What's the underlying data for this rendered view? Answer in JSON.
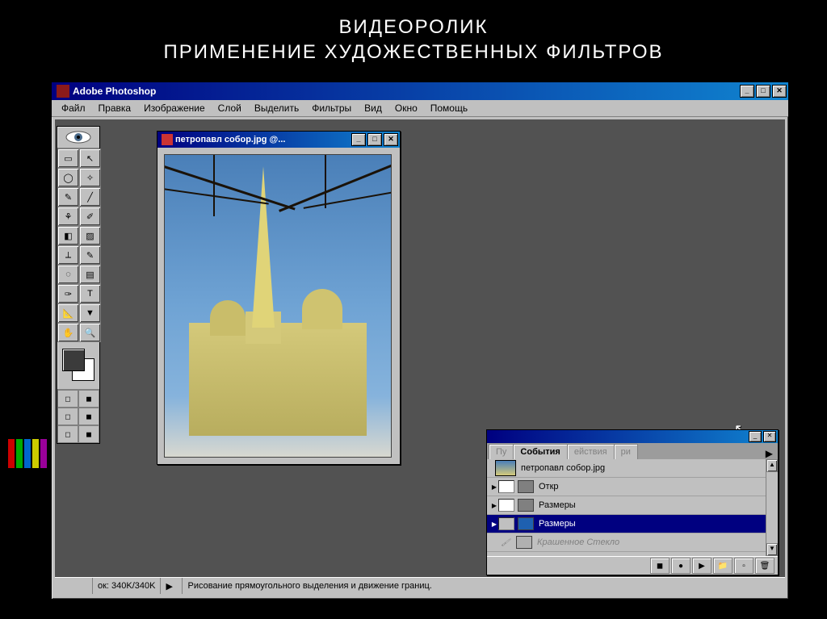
{
  "slide": {
    "title_line1": "ВИДЕОРОЛИК",
    "title_line2": "ПРИМЕНЕНИЕ ХУДОЖЕСТВЕННЫХ ФИЛЬТРОВ"
  },
  "app": {
    "title": "Adobe Photoshop",
    "menus": [
      "Файл",
      "Правка",
      "Изображение",
      "Слой",
      "Выделить",
      "Фильтры",
      "Вид",
      "Окно",
      "Помощь"
    ]
  },
  "toolbox": {
    "tools": [
      "▭",
      "↖",
      "◯",
      "✧",
      "✎",
      "╱",
      "⚘",
      "✐",
      "◧",
      "▨",
      "⟂",
      "✎",
      "◌",
      "▤",
      "✑",
      "T",
      "📐",
      "▼",
      "✋",
      "🔍"
    ],
    "modes": [
      "◻",
      "◼",
      "◻",
      "◼",
      "◻",
      "◼"
    ]
  },
  "document": {
    "title": "петропавл собор.jpg @..."
  },
  "palette": {
    "tabs_partial_left": "Пу",
    "tab_active": "События",
    "tabs_partial_right": "ействия",
    "tabs_partial_right2": "ри",
    "rows": [
      {
        "type": "head",
        "label": "петропавл собор.jpg"
      },
      {
        "type": "item",
        "label": "Откр"
      },
      {
        "type": "item",
        "label": "Размеры"
      },
      {
        "type": "sel",
        "label": "Размеры"
      },
      {
        "type": "italic",
        "label": "Крашенное Стекло"
      }
    ]
  },
  "status": {
    "doc": "ок: 340K/340K",
    "hint": "Рисование прямоугольного выделения и движение границ."
  },
  "window_controls": {
    "min": "_",
    "max": "□",
    "close": "✕"
  },
  "deco_colors": [
    "#c00",
    "#0a0",
    "#06c",
    "#cc0",
    "#909"
  ]
}
